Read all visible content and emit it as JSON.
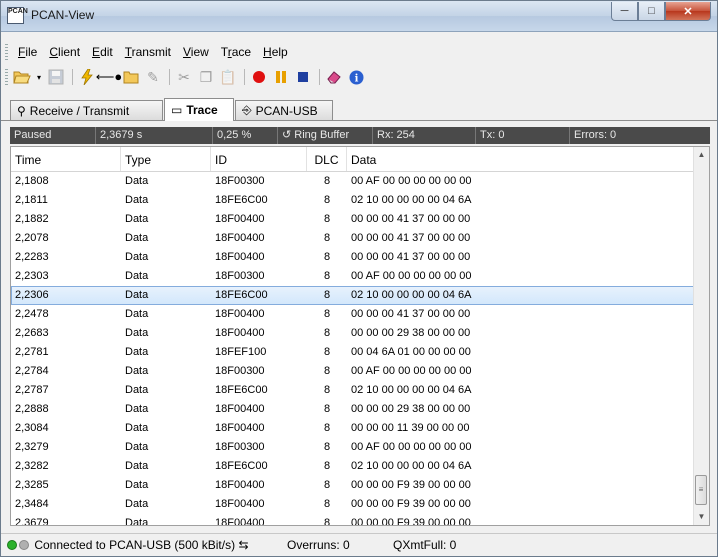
{
  "window": {
    "title": "PCAN-View",
    "icon_text": "PCAN"
  },
  "menu": {
    "items": [
      {
        "label": "File"
      },
      {
        "label": "Client"
      },
      {
        "label": "Edit"
      },
      {
        "label": "Transmit"
      },
      {
        "label": "View"
      },
      {
        "label": "Trace"
      },
      {
        "label": "Help"
      }
    ]
  },
  "tabs": [
    {
      "label": "Receive / Transmit",
      "icon": "⚲"
    },
    {
      "label": "Trace",
      "icon": "▭"
    },
    {
      "label": "PCAN-USB",
      "icon": "⎆"
    }
  ],
  "infobar": {
    "state": "Paused",
    "time": "2,3679 s",
    "percent": "0,25 %",
    "buffer": "Ring Buffer",
    "rx": "Rx: 254",
    "tx": "Tx: 0",
    "errors": "Errors: 0"
  },
  "table": {
    "columns": [
      "Time",
      "Type",
      "ID",
      "DLC",
      "Data"
    ],
    "rows": [
      {
        "time": "2,1808",
        "type": "Data",
        "id": "18F00300",
        "dlc": "8",
        "data": "00 AF 00 00 00 00 00 00"
      },
      {
        "time": "2,1811",
        "type": "Data",
        "id": "18FE6C00",
        "dlc": "8",
        "data": "02 10 00 00 00 00 04 6A"
      },
      {
        "time": "2,1882",
        "type": "Data",
        "id": "18F00400",
        "dlc": "8",
        "data": "00 00 00 41 37 00 00 00"
      },
      {
        "time": "2,2078",
        "type": "Data",
        "id": "18F00400",
        "dlc": "8",
        "data": "00 00 00 41 37 00 00 00"
      },
      {
        "time": "2,2283",
        "type": "Data",
        "id": "18F00400",
        "dlc": "8",
        "data": "00 00 00 41 37 00 00 00"
      },
      {
        "time": "2,2303",
        "type": "Data",
        "id": "18F00300",
        "dlc": "8",
        "data": "00 AF 00 00 00 00 00 00"
      },
      {
        "time": "2,2306",
        "type": "Data",
        "id": "18FE6C00",
        "dlc": "8",
        "data": "02 10 00 00 00 00 04 6A"
      },
      {
        "time": "2,2478",
        "type": "Data",
        "id": "18F00400",
        "dlc": "8",
        "data": "00 00 00 41 37 00 00 00"
      },
      {
        "time": "2,2683",
        "type": "Data",
        "id": "18F00400",
        "dlc": "8",
        "data": "00 00 00 29 38 00 00 00"
      },
      {
        "time": "2,2781",
        "type": "Data",
        "id": "18FEF100",
        "dlc": "8",
        "data": "00 04 6A 01 00 00 00 00"
      },
      {
        "time": "2,2784",
        "type": "Data",
        "id": "18F00300",
        "dlc": "8",
        "data": "00 AF 00 00 00 00 00 00"
      },
      {
        "time": "2,2787",
        "type": "Data",
        "id": "18FE6C00",
        "dlc": "8",
        "data": "02 10 00 00 00 00 04 6A"
      },
      {
        "time": "2,2888",
        "type": "Data",
        "id": "18F00400",
        "dlc": "8",
        "data": "00 00 00 29 38 00 00 00"
      },
      {
        "time": "2,3084",
        "type": "Data",
        "id": "18F00400",
        "dlc": "8",
        "data": "00 00 00 11 39 00 00 00"
      },
      {
        "time": "2,3279",
        "type": "Data",
        "id": "18F00300",
        "dlc": "8",
        "data": "00 AF 00 00 00 00 00 00"
      },
      {
        "time": "2,3282",
        "type": "Data",
        "id": "18FE6C00",
        "dlc": "8",
        "data": "02 10 00 00 00 00 04 6A"
      },
      {
        "time": "2,3285",
        "type": "Data",
        "id": "18F00400",
        "dlc": "8",
        "data": "00 00 00 F9 39 00 00 00"
      },
      {
        "time": "2,3484",
        "type": "Data",
        "id": "18F00400",
        "dlc": "8",
        "data": "00 00 00 F9 39 00 00 00"
      },
      {
        "time": "2,3679",
        "type": "Data",
        "id": "18F00400",
        "dlc": "8",
        "data": "00 00 00 F9 39 00 00 00"
      }
    ]
  },
  "statusbar": {
    "connection": "Connected to PCAN-USB (500 kBit/s)",
    "overruns": "Overruns: 0",
    "qxmtfull": "QXmtFull: 0"
  },
  "colors": {
    "accent": "#3f7fd0",
    "selection": "#d2e7fb",
    "record": "#e01010",
    "pause": "#e8a000",
    "stop": "#1f3fa0",
    "connected": "#2bb12b"
  }
}
